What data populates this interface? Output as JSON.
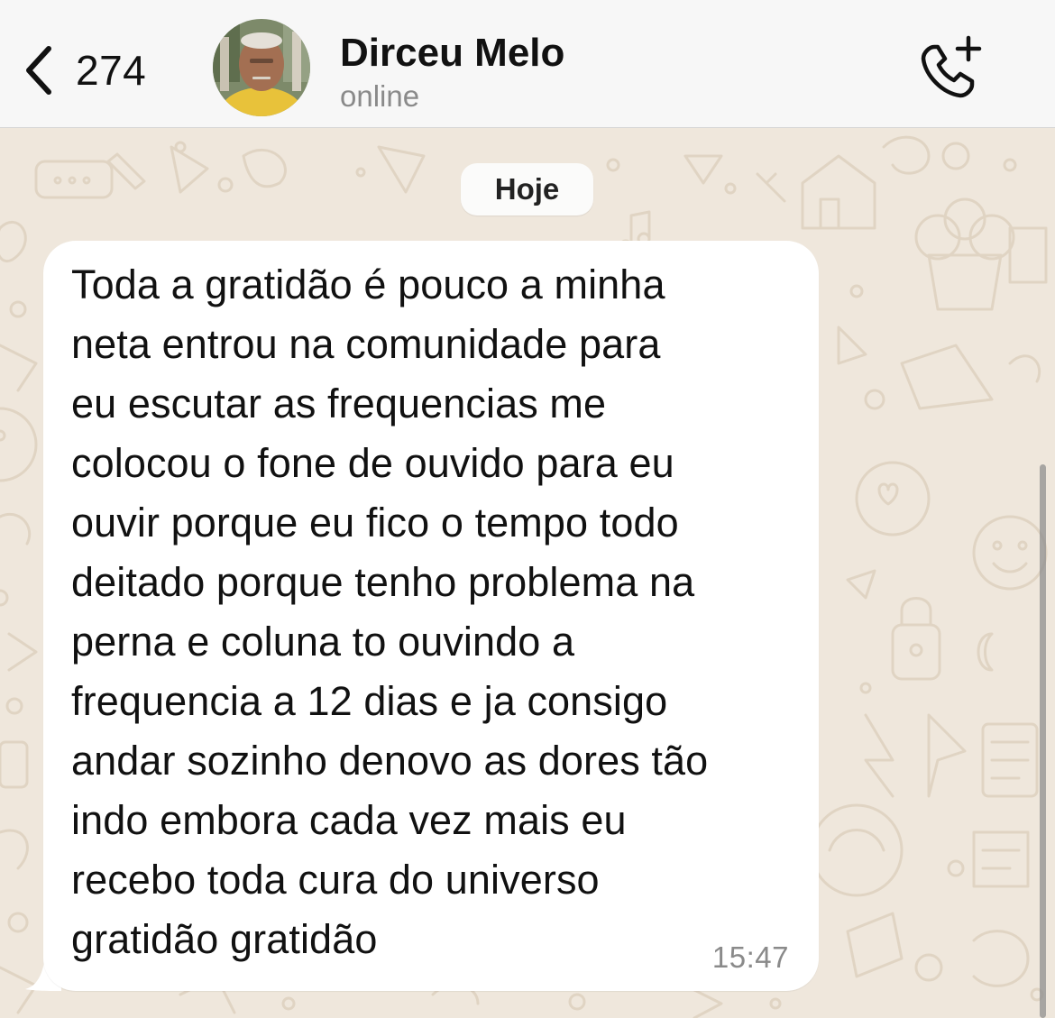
{
  "header": {
    "unread_count": "274",
    "contact_name": "Dirceu Melo",
    "contact_status": "online"
  },
  "chat": {
    "date_separator": "Hoje",
    "messages": [
      {
        "text": "Toda a gratidão é pouco a minha\nneta entrou na comunidade para\neu escutar as frequencias me\ncolocou o fone de ouvido para eu\nouvir porque eu fico o tempo todo\ndeitado porque tenho problema na\nperna e coluna to ouvindo a\nfrequencia a 12 dias e ja consigo\nandar sozinho denovo as dores tão\nindo embora cada vez mais eu\nrecebo toda cura do universo\ngratidão gratidão",
        "time": "15:47",
        "direction": "incoming"
      }
    ]
  },
  "icons": {
    "back": "chevron-left-icon",
    "call": "phone-plus-icon"
  },
  "colors": {
    "wallpaper": "#efe7dc",
    "bubble_incoming": "#ffffff",
    "header_bg": "#f7f7f7",
    "status_text": "#8a8a8a"
  }
}
